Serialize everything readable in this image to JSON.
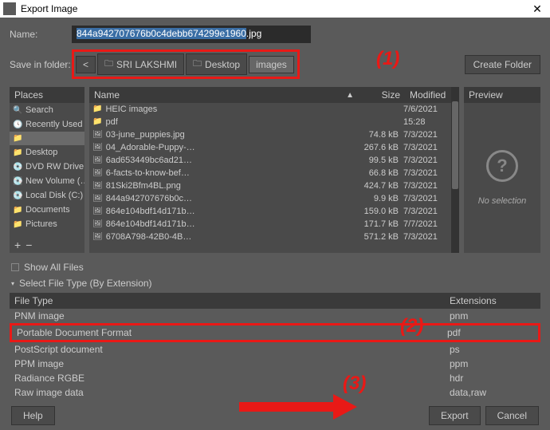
{
  "titlebar": {
    "title": "Export Image"
  },
  "name_row": {
    "label": "Name:",
    "filename_base": "844a942707676b0c4debb674299e1960",
    "filename_ext": ".jpg"
  },
  "save_row": {
    "label": "Save in folder:",
    "back": "<",
    "crumbs": [
      {
        "label": "SRI LAKSHMI"
      },
      {
        "label": "Desktop"
      },
      {
        "label": "images",
        "active": true
      }
    ],
    "create_folder": "Create Folder"
  },
  "annotations": {
    "one": "(1)",
    "two": "(2)",
    "three": "(3)"
  },
  "places": {
    "header": "Places",
    "items": [
      {
        "icon": "🔍",
        "label": "Search"
      },
      {
        "icon": "🕓",
        "label": "Recently Used"
      },
      {
        "icon": "📁",
        "label": "",
        "selected": true
      },
      {
        "icon": "📁",
        "label": "Desktop"
      },
      {
        "icon": "💿",
        "label": "DVD RW Drive…"
      },
      {
        "icon": "💽",
        "label": "New Volume (…"
      },
      {
        "icon": "💽",
        "label": "Local Disk (C:)"
      },
      {
        "icon": "📁",
        "label": "Documents"
      },
      {
        "icon": "📁",
        "label": "Pictures"
      }
    ],
    "add": "+",
    "remove": "−"
  },
  "filelist": {
    "headers": {
      "name": "Name",
      "size": "Size",
      "modified": "Modified"
    },
    "files": [
      {
        "icon": "📁",
        "name": "HEIC images",
        "size": "",
        "modified": "7/6/2021"
      },
      {
        "icon": "📁",
        "name": "pdf",
        "size": "",
        "modified": "15:28"
      },
      {
        "icon": "🖼",
        "name": "03-june_puppies.jpg",
        "size": "74.8 kB",
        "modified": "7/3/2021"
      },
      {
        "icon": "🖼",
        "name": "04_Adorable-Puppy-…",
        "size": "267.6 kB",
        "modified": "7/3/2021"
      },
      {
        "icon": "🖼",
        "name": "6ad653449bc6ad21…",
        "size": "99.5 kB",
        "modified": "7/3/2021"
      },
      {
        "icon": "🖼",
        "name": "6-facts-to-know-bef…",
        "size": "66.8 kB",
        "modified": "7/3/2021"
      },
      {
        "icon": "🖼",
        "name": "81Ski2Bfm4BL.png",
        "size": "424.7 kB",
        "modified": "7/3/2021"
      },
      {
        "icon": "🖼",
        "name": "844a942707676b0c…",
        "size": "9.9 kB",
        "modified": "7/3/2021"
      },
      {
        "icon": "🖼",
        "name": "864e104bdf14d171b…",
        "size": "159.0 kB",
        "modified": "7/3/2021"
      },
      {
        "icon": "🖼",
        "name": "864e104bdf14d171b…",
        "size": "171.7 kB",
        "modified": "7/7/2021"
      },
      {
        "icon": "🖼",
        "name": "6708A798-42B0-4B…",
        "size": "571.2 kB",
        "modified": "7/3/2021"
      }
    ]
  },
  "preview": {
    "header": "Preview",
    "text": "No selection"
  },
  "options": {
    "show_all": "Show All Files",
    "select_type": "Select File Type (By Extension)"
  },
  "filetype": {
    "headers": {
      "type": "File Type",
      "ext": "Extensions"
    },
    "rows": [
      {
        "type": "PNM image",
        "ext": "pnm"
      },
      {
        "type": "Portable Document Format",
        "ext": "pdf",
        "highlight": true
      },
      {
        "type": "PostScript document",
        "ext": "ps"
      },
      {
        "type": "PPM image",
        "ext": "ppm"
      },
      {
        "type": "Radiance RGBE",
        "ext": "hdr"
      },
      {
        "type": "Raw image data",
        "ext": "data,raw"
      }
    ]
  },
  "buttons": {
    "help": "Help",
    "export": "Export",
    "cancel": "Cancel"
  }
}
